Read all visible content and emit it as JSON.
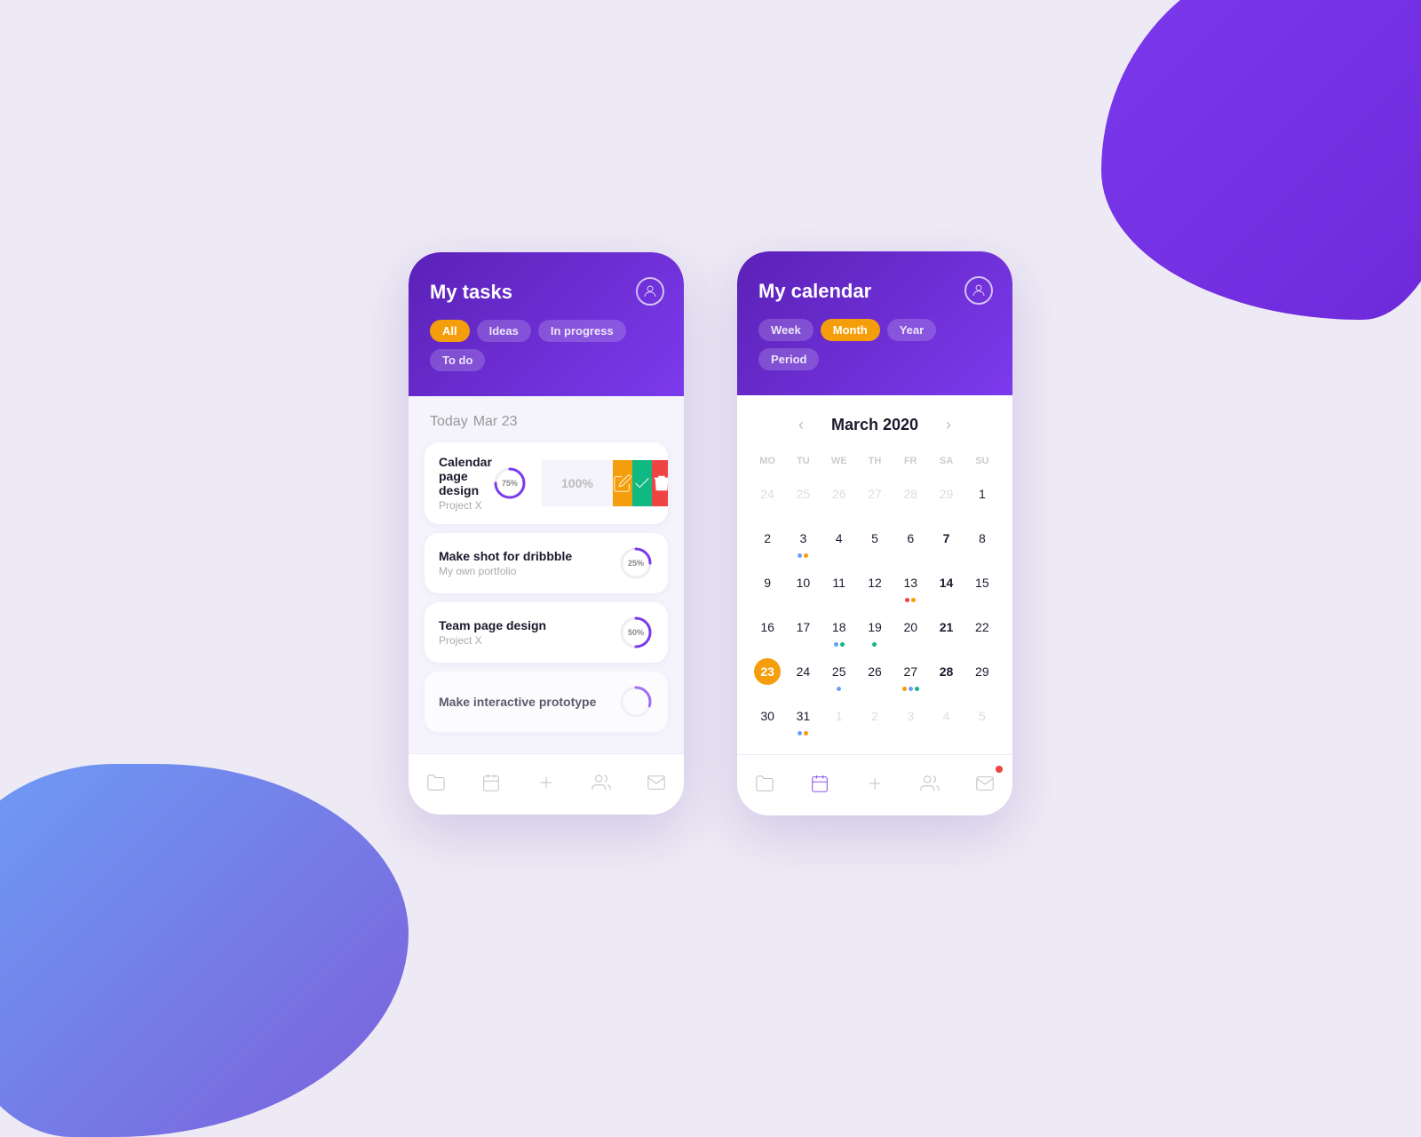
{
  "background": {
    "color": "#eeeaf5"
  },
  "tasks_card": {
    "title": "My tasks",
    "tabs": [
      {
        "label": "All",
        "active": true
      },
      {
        "label": "Ideas",
        "active": false
      },
      {
        "label": "In progress",
        "active": false
      },
      {
        "label": "To do",
        "active": false
      }
    ],
    "today_label": "Today",
    "today_date": "Mar 23",
    "tasks": [
      {
        "title": "Calendar page design",
        "subtitle": "Project X",
        "progress": 75,
        "expanded": true
      },
      {
        "title": "Make shot for dribbble",
        "subtitle": "My own portfolio",
        "progress": 25,
        "expanded": false
      },
      {
        "title": "Team page design",
        "subtitle": "Project X",
        "progress": 50,
        "expanded": false
      },
      {
        "title": "Make interactive prototype",
        "subtitle": "",
        "progress": 30,
        "expanded": false
      }
    ],
    "action_buttons": {
      "edit_label": "edit",
      "check_label": "check",
      "delete_label": "delete"
    },
    "bottom_nav": [
      "folder",
      "calendar",
      "add",
      "users",
      "mail"
    ]
  },
  "calendar_card": {
    "title": "My calendar",
    "tabs": [
      {
        "label": "Week",
        "active": false
      },
      {
        "label": "Month",
        "active": true
      },
      {
        "label": "Year",
        "active": false
      },
      {
        "label": "Period",
        "active": false
      }
    ],
    "month_year": "March 2020",
    "weekdays": [
      "MO",
      "TU",
      "WE",
      "TH",
      "FR",
      "SA",
      "SU"
    ],
    "weeks": [
      [
        {
          "day": "24",
          "other": true,
          "today": false,
          "bold": false,
          "dots": []
        },
        {
          "day": "25",
          "other": true,
          "today": false,
          "bold": false,
          "dots": []
        },
        {
          "day": "26",
          "other": true,
          "today": false,
          "bold": false,
          "dots": []
        },
        {
          "day": "27",
          "other": true,
          "today": false,
          "bold": false,
          "dots": []
        },
        {
          "day": "28",
          "other": true,
          "today": false,
          "bold": false,
          "dots": []
        },
        {
          "day": "29",
          "other": true,
          "today": false,
          "bold": false,
          "dots": []
        },
        {
          "day": "1",
          "other": false,
          "today": false,
          "bold": false,
          "dots": []
        }
      ],
      [
        {
          "day": "2",
          "other": false,
          "today": false,
          "bold": false,
          "dots": []
        },
        {
          "day": "3",
          "other": false,
          "today": false,
          "bold": false,
          "dots": [
            "blue",
            "orange"
          ]
        },
        {
          "day": "4",
          "other": false,
          "today": false,
          "bold": false,
          "dots": []
        },
        {
          "day": "5",
          "other": false,
          "today": false,
          "bold": false,
          "dots": []
        },
        {
          "day": "6",
          "other": false,
          "today": false,
          "bold": false,
          "dots": []
        },
        {
          "day": "7",
          "other": false,
          "today": false,
          "bold": true,
          "dots": []
        },
        {
          "day": "8",
          "other": false,
          "today": false,
          "bold": false,
          "dots": []
        }
      ],
      [
        {
          "day": "9",
          "other": false,
          "today": false,
          "bold": false,
          "dots": []
        },
        {
          "day": "10",
          "other": false,
          "today": false,
          "bold": false,
          "dots": []
        },
        {
          "day": "11",
          "other": false,
          "today": false,
          "bold": false,
          "dots": []
        },
        {
          "day": "12",
          "other": false,
          "today": false,
          "bold": false,
          "dots": []
        },
        {
          "day": "13",
          "other": false,
          "today": false,
          "bold": false,
          "dots": [
            "red",
            "orange"
          ]
        },
        {
          "day": "14",
          "other": false,
          "today": false,
          "bold": true,
          "dots": []
        },
        {
          "day": "15",
          "other": false,
          "today": false,
          "bold": false,
          "dots": []
        }
      ],
      [
        {
          "day": "16",
          "other": false,
          "today": false,
          "bold": false,
          "dots": []
        },
        {
          "day": "17",
          "other": false,
          "today": false,
          "bold": false,
          "dots": []
        },
        {
          "day": "18",
          "other": false,
          "today": false,
          "bold": false,
          "dots": [
            "blue",
            "green"
          ]
        },
        {
          "day": "19",
          "other": false,
          "today": false,
          "bold": false,
          "dots": [
            "green"
          ]
        },
        {
          "day": "20",
          "other": false,
          "today": false,
          "bold": false,
          "dots": []
        },
        {
          "day": "21",
          "other": false,
          "today": false,
          "bold": true,
          "dots": []
        },
        {
          "day": "22",
          "other": false,
          "today": false,
          "bold": false,
          "dots": []
        }
      ],
      [
        {
          "day": "23",
          "other": false,
          "today": true,
          "bold": true,
          "dots": []
        },
        {
          "day": "24",
          "other": false,
          "today": false,
          "bold": false,
          "dots": []
        },
        {
          "day": "25",
          "other": false,
          "today": false,
          "bold": false,
          "dots": [
            "blue"
          ]
        },
        {
          "day": "26",
          "other": false,
          "today": false,
          "bold": false,
          "dots": []
        },
        {
          "day": "27",
          "other": false,
          "today": false,
          "bold": false,
          "dots": [
            "orange",
            "blue",
            "green"
          ]
        },
        {
          "day": "28",
          "other": false,
          "today": false,
          "bold": true,
          "dots": []
        },
        {
          "day": "29",
          "other": false,
          "today": false,
          "bold": false,
          "dots": []
        }
      ],
      [
        {
          "day": "30",
          "other": false,
          "today": false,
          "bold": false,
          "dots": []
        },
        {
          "day": "31",
          "other": false,
          "today": false,
          "bold": false,
          "dots": [
            "blue",
            "orange"
          ]
        },
        {
          "day": "1",
          "other": true,
          "today": false,
          "bold": false,
          "dots": []
        },
        {
          "day": "2",
          "other": true,
          "today": false,
          "bold": false,
          "dots": []
        },
        {
          "day": "3",
          "other": true,
          "today": false,
          "bold": false,
          "dots": []
        },
        {
          "day": "4",
          "other": true,
          "today": false,
          "bold": false,
          "dots": []
        },
        {
          "day": "5",
          "other": true,
          "today": false,
          "bold": false,
          "dots": []
        }
      ]
    ],
    "bottom_nav": [
      "folder",
      "calendar",
      "add",
      "users",
      "mail-badge"
    ]
  }
}
